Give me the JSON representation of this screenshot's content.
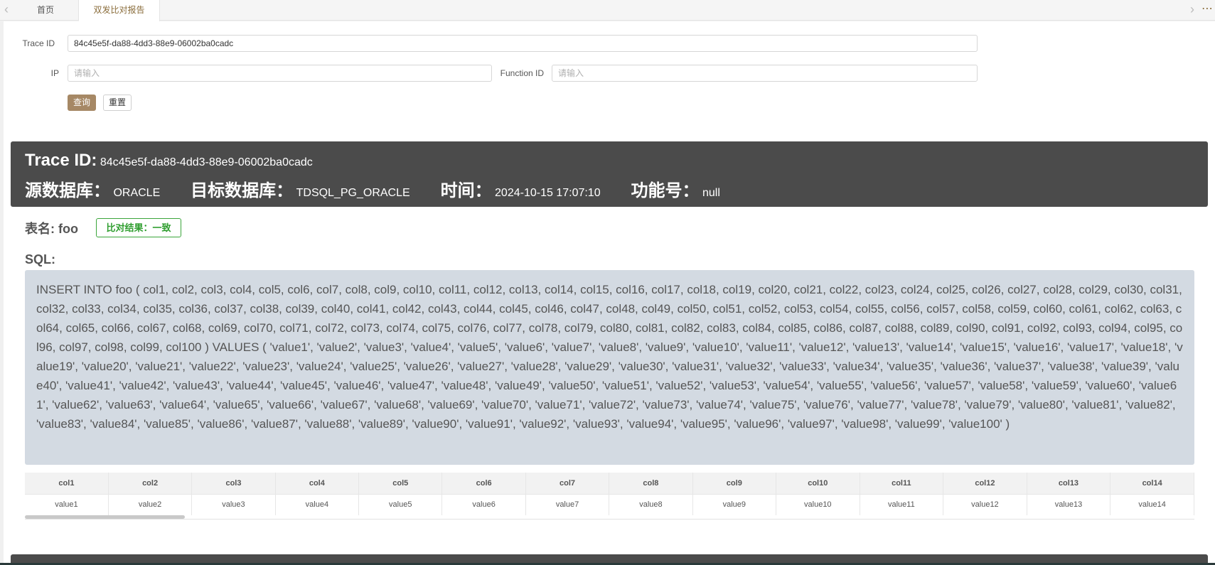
{
  "tabs": [
    {
      "label": "首页",
      "active": false
    },
    {
      "label": "双发比对报告",
      "active": true
    }
  ],
  "form": {
    "trace_id_label": "Trace ID",
    "trace_id_value": "84c45e5f-da88-4dd3-88e9-06002ba0cadc",
    "ip_label": "IP",
    "ip_placeholder": "请输入",
    "function_id_label": "Function ID",
    "function_id_placeholder": "请输入",
    "query_button": "查询",
    "reset_button": "重置"
  },
  "report": {
    "trace_label": "Trace ID:",
    "trace_value": "84c45e5f-da88-4dd3-88e9-06002ba0cadc",
    "source_db_label": "源数据库：",
    "source_db_value": "ORACLE",
    "target_db_label": "目标数据库：",
    "target_db_value": "TDSQL_PG_ORACLE",
    "time_label": "时间：",
    "time_value": "2024-10-15 17:07:10",
    "function_label": "功能号：",
    "function_value": "null",
    "table_name": "表名: foo",
    "result_badge": "比对结果：一致",
    "sql_title": "SQL:",
    "sql_text": "INSERT INTO foo ( col1, col2, col3, col4, col5, col6, col7, col8, col9, col10, col11, col12, col13, col14, col15, col16, col17, col18, col19, col20, col21, col22, col23, col24, col25, col26, col27, col28, col29, col30, col31, col32, col33, col34, col35, col36, col37, col38, col39, col40, col41, col42, col43, col44, col45, col46, col47, col48, col49, col50, col51, col52, col53, col54, col55, col56, col57, col58, col59, col60, col61, col62, col63, col64, col65, col66, col67, col68, col69, col70, col71, col72, col73, col74, col75, col76, col77, col78, col79, col80, col81, col82, col83, col84, col85, col86, col87, col88, col89, col90, col91, col92, col93, col94, col95, col96, col97, col98, col99, col100 ) VALUES ( 'value1', 'value2', 'value3', 'value4', 'value5', 'value6', 'value7', 'value8', 'value9', 'value10', 'value11', 'value12', 'value13', 'value14', 'value15', 'value16', 'value17', 'value18', 'value19', 'value20', 'value21', 'value22', 'value23', 'value24', 'value25', 'value26', 'value27', 'value28', 'value29', 'value30', 'value31', 'value32', 'value33', 'value34', 'value35', 'value36', 'value37', 'value38', 'value39', 'value40', 'value41', 'value42', 'value43', 'value44', 'value45', 'value46', 'value47', 'value48', 'value49', 'value50', 'value51', 'value52', 'value53', 'value54', 'value55', 'value56', 'value57', 'value58', 'value59', 'value60', 'value61', 'value62', 'value63', 'value64', 'value65', 'value66', 'value67', 'value68', 'value69', 'value70', 'value71', 'value72', 'value73', 'value74', 'value75', 'value76', 'value77', 'value78', 'value79', 'value80', 'value81', 'value82', 'value83', 'value84', 'value85', 'value86', 'value87', 'value88', 'value89', 'value90', 'value91', 'value92', 'value93', 'value94', 'value95', 'value96', 'value97', 'value98', 'value99', 'value100' )"
  },
  "table": {
    "columns": [
      "col1",
      "col2",
      "col3",
      "col4",
      "col5",
      "col6",
      "col7",
      "col8",
      "col9",
      "col10",
      "col11",
      "col12",
      "col13",
      "col14"
    ],
    "rows": [
      [
        "value1",
        "value2",
        "value3",
        "value4",
        "value5",
        "value6",
        "value7",
        "value8",
        "value9",
        "value10",
        "value11",
        "value12",
        "value13",
        "value14"
      ]
    ]
  },
  "icons": {
    "tab_left": "chevron-left-icon",
    "tab_right": "chevron-right-icon",
    "tab_more": "more-icon"
  },
  "colors": {
    "primary_button": "#a68865",
    "header_card": "#4b4b4b",
    "sql_box": "#d3dae2",
    "result_badge": "#2f9e2f"
  }
}
